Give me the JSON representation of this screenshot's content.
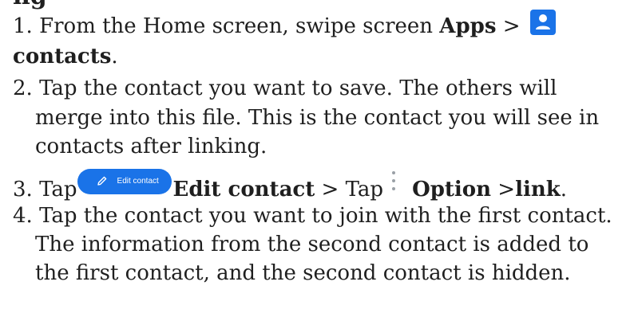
{
  "heading_fragment": "ng",
  "steps": {
    "s1_a": "1. From the Home screen, swipe screen ",
    "s1_apps": "Apps",
    "s1_b": " >",
    "s1_contacts": "contacts",
    "s1_end": ".",
    "s2_l1": "2. Tap the contact you want to save. The others will",
    "s2_l2": "merge into this file. This is the contact you will see in",
    "s2_l3": "contacts after linking.",
    "s3_tap": "3. Tap",
    "s3_edit": "Edit contact",
    "s3_mid": " > Tap",
    "s3_option": "Option",
    "s3_gt": " >",
    "s3_link": "link",
    "s3_end": ".",
    "s4_l1": "4. Tap the contact you want to join with the first contact.",
    "s4_l2": "The information from the second contact is added to",
    "s4_l3": "the first contact, and the second contact is hidden."
  },
  "edit_button_label": "Edit contact",
  "icons": {
    "contacts": "contacts-app-icon",
    "edit": "pencil-icon",
    "options": "more-vert-icon"
  },
  "colors": {
    "accent": "#1a73e8",
    "text": "#1f1f1f",
    "kebab": "#9aa0a6"
  }
}
